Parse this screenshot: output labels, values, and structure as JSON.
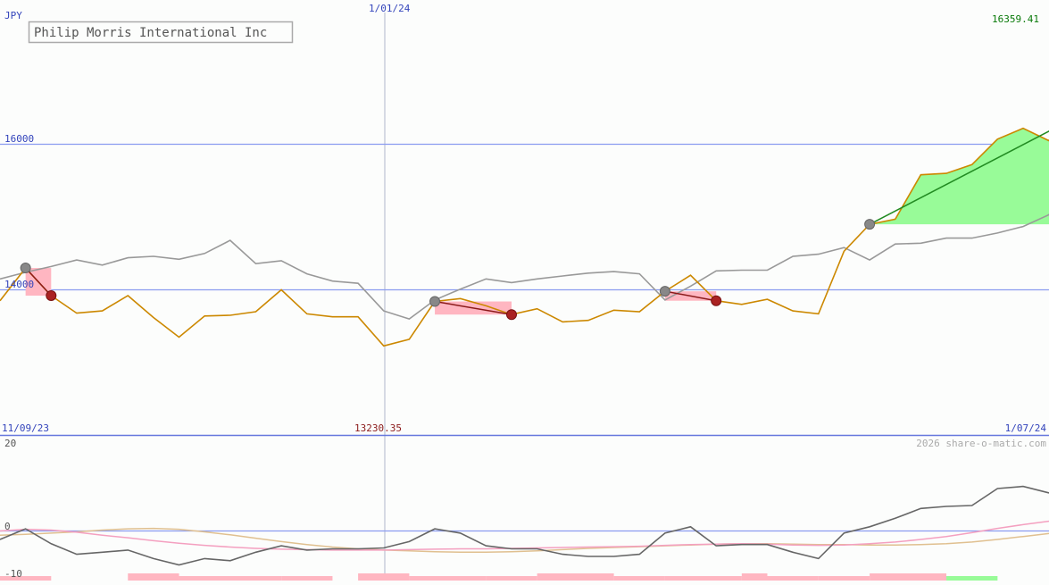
{
  "title": "Philip Morris International Inc",
  "currency": "JPY",
  "date_top": "1/01/24",
  "max_label": "16359.41",
  "min_label": "13230.35",
  "date_start": "11/09/23",
  "date_end": "1/07/24",
  "credit": "2026 share-o-matic.com",
  "colors": {
    "price": "#cc8800",
    "average": "#999999",
    "gain_fill": "#98fb98",
    "loss_fill": "#ffb6c1",
    "gain_line": "#228b22",
    "loss_line": "#8b1a1a",
    "grid": "#8a9cf0",
    "label_blue": "#3344bb",
    "label_green": "#0a7a0a",
    "label_red": "#8b1a1a"
  },
  "chart_data": [
    {
      "type": "line",
      "title": "Philip Morris International Inc",
      "ylabel": "JPY",
      "y_ticks": [
        14000,
        16000
      ],
      "ylim": [
        12000,
        18000
      ],
      "x_range": [
        "11/09/23",
        "1/07/24"
      ],
      "x_marker": "1/01/24",
      "series": [
        {
          "key": "price",
          "values": [
            13850,
            14300,
            13920,
            13680,
            13710,
            13920,
            13620,
            13350,
            13640,
            13650,
            13700,
            14000,
            13670,
            13630,
            13630,
            13230,
            13320,
            13840,
            13880,
            13780,
            13660,
            13740,
            13560,
            13580,
            13720,
            13700,
            13980,
            14200,
            13850,
            13800,
            13870,
            13710,
            13670,
            14530,
            14900,
            14970,
            15580,
            15600,
            15720,
            16070,
            16220,
            16050,
            16359.41
          ]
        },
        {
          "key": "average",
          "values": [
            14150,
            14240,
            14320,
            14410,
            14340,
            14440,
            14460,
            14420,
            14500,
            14680,
            14360,
            14400,
            14220,
            14120,
            14090,
            13710,
            13600,
            13860,
            14010,
            14150,
            14100,
            14150,
            14190,
            14230,
            14250,
            14220,
            13860,
            14050,
            14260,
            14270,
            14270,
            14460,
            14490,
            14580,
            14410,
            14630,
            14640,
            14710,
            14710,
            14780,
            14870,
            15030,
            15350
          ]
        }
      ],
      "signals": [
        {
          "from": 1,
          "to": 2,
          "kind": "loss"
        },
        {
          "from": 17,
          "to": 20,
          "kind": "loss"
        },
        {
          "from": 26,
          "to": 28,
          "kind": "loss"
        },
        {
          "from": 34,
          "to": 42,
          "kind": "gain"
        }
      ]
    },
    {
      "type": "line",
      "y_ticks": [
        20,
        0,
        -10
      ],
      "ylim": [
        -10,
        20
      ],
      "series": [
        {
          "key": "momentum",
          "values": [
            -2,
            0.5,
            -3,
            -5.5,
            -5,
            -4.5,
            -6.5,
            -8,
            -6.5,
            -7,
            -5,
            -3.5,
            -4.5,
            -4.2,
            -4.2,
            -4,
            -2.5,
            0.5,
            -0.5,
            -3.5,
            -4.2,
            -4.2,
            -5.5,
            -6,
            -6,
            -5.5,
            -0.5,
            1,
            -3.5,
            -3.2,
            -3.2,
            -5,
            -6.5,
            -0.5,
            1,
            3,
            5.3,
            5.8,
            6,
            10,
            10.5,
            9,
            8.1
          ]
        },
        {
          "key": "signal_pink",
          "values": [
            0,
            0.4,
            0.2,
            -0.3,
            -1,
            -1.6,
            -2.3,
            -2.9,
            -3.4,
            -3.8,
            -4.1,
            -4.3,
            -4.4,
            -4.5,
            -4.5,
            -4.5,
            -4.4,
            -4.3,
            -4.2,
            -4.2,
            -4.1,
            -4.0,
            -3.9,
            -3.8,
            -3.7,
            -3.6,
            -3.4,
            -3.2,
            -3.1,
            -3.0,
            -3.1,
            -3.3,
            -3.4,
            -3.3,
            -3.0,
            -2.6,
            -2.0,
            -1.3,
            -0.4,
            0.6,
            1.5,
            2.3,
            2.7
          ]
        },
        {
          "key": "signal_tan",
          "values": [
            -1,
            -0.8,
            -0.5,
            -0.2,
            0.2,
            0.5,
            0.6,
            0.4,
            -0.2,
            -0.9,
            -1.7,
            -2.5,
            -3.2,
            -3.8,
            -4.2,
            -4.5,
            -4.7,
            -4.9,
            -5,
            -5,
            -4.9,
            -4.7,
            -4.4,
            -4.1,
            -3.9,
            -3.7,
            -3.5,
            -3.3,
            -3.1,
            -3.0,
            -3.0,
            -3.1,
            -3.2,
            -3.2,
            -3.3,
            -3.3,
            -3.2,
            -3.0,
            -2.6,
            -2.0,
            -1.3,
            -0.6,
            0
          ]
        }
      ],
      "volume_bars": [
        {
          "start": 0,
          "end": 2,
          "kind": "loss"
        },
        {
          "start": 5,
          "end": 7,
          "kind": "loss"
        },
        {
          "start": 7,
          "end": 11,
          "kind": "loss"
        },
        {
          "start": 11,
          "end": 13,
          "kind": "loss"
        },
        {
          "start": 14,
          "end": 16,
          "kind": "loss"
        },
        {
          "start": 16,
          "end": 19,
          "kind": "loss"
        },
        {
          "start": 19,
          "end": 21,
          "kind": "loss"
        },
        {
          "start": 21,
          "end": 24,
          "kind": "loss"
        },
        {
          "start": 24,
          "end": 26,
          "kind": "loss"
        },
        {
          "start": 26,
          "end": 29,
          "kind": "loss"
        },
        {
          "start": 29,
          "end": 30,
          "kind": "loss"
        },
        {
          "start": 30,
          "end": 32,
          "kind": "loss"
        },
        {
          "start": 32,
          "end": 34,
          "kind": "loss"
        },
        {
          "start": 34,
          "end": 37,
          "kind": "loss"
        },
        {
          "start": 37,
          "end": 39,
          "kind": "gain"
        }
      ]
    }
  ]
}
